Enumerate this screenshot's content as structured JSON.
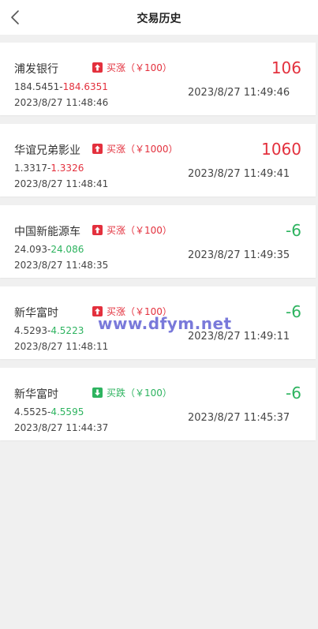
{
  "header": {
    "title": "交易历史",
    "back_icon": "chevron-left-icon"
  },
  "colors": {
    "up": "#e3303d",
    "down": "#2db35f",
    "text": "#333333",
    "background": "#f0f0f0"
  },
  "trades": [
    {
      "name": "浦发银行",
      "direction": "up",
      "direction_label": "买涨（￥100）",
      "open_price": "184.5451",
      "separator": "-",
      "close_price": "184.6351",
      "open_time": "2023/8/27 11:48:46",
      "close_time": "2023/8/27 11:49:46",
      "pnl": "106",
      "pnl_color": "up",
      "close_price_color": "up"
    },
    {
      "name": "华谊兄弟影业",
      "direction": "up",
      "direction_label": "买涨（￥1000）",
      "open_price": "1.3317",
      "separator": "-",
      "close_price": "1.3326",
      "open_time": "2023/8/27 11:48:41",
      "close_time": "2023/8/27 11:49:41",
      "pnl": "1060",
      "pnl_color": "up",
      "close_price_color": "up"
    },
    {
      "name": "中国新能源车",
      "direction": "up",
      "direction_label": "买涨（￥100）",
      "open_price": "24.093",
      "separator": "-",
      "close_price": "24.086",
      "open_time": "2023/8/27 11:48:35",
      "close_time": "2023/8/27 11:49:35",
      "pnl": "-6",
      "pnl_color": "down",
      "close_price_color": "down"
    },
    {
      "name": "新华富时",
      "direction": "up",
      "direction_label": "买涨（￥100）",
      "open_price": "4.5293",
      "separator": "-",
      "close_price": "4.5223",
      "open_time": "2023/8/27 11:48:11",
      "close_time": "2023/8/27 11:49:11",
      "pnl": "-6",
      "pnl_color": "down",
      "close_price_color": "down"
    },
    {
      "name": "新华富时",
      "direction": "down",
      "direction_label": "买跌（￥100）",
      "open_price": "4.5525",
      "separator": "-",
      "close_price": "4.5595",
      "open_time": "2023/8/27 11:44:37",
      "close_time": "2023/8/27 11:45:37",
      "pnl": "-6",
      "pnl_color": "down",
      "close_price_color": "down"
    }
  ],
  "watermark": "www.dfym.net"
}
